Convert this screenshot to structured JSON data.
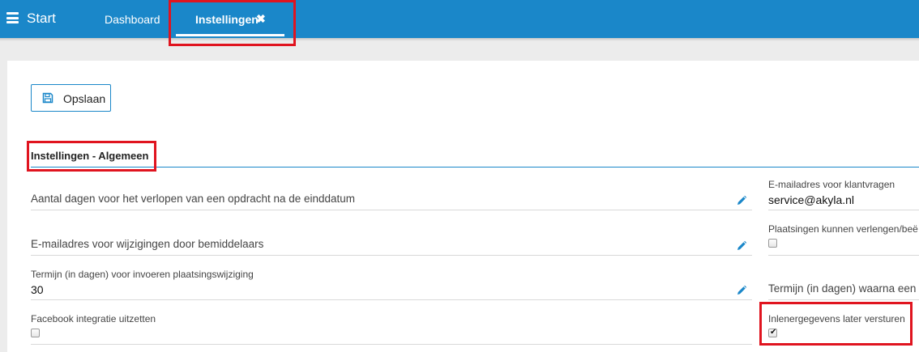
{
  "topbar": {
    "brand": "Start",
    "tabs": [
      {
        "label": "Dashboard"
      },
      {
        "label": "Instellingen",
        "close": "✖"
      }
    ]
  },
  "toolbar": {
    "save_label": "Opslaan"
  },
  "section": {
    "title": "Instellingen - Algemeen"
  },
  "left_fields": [
    {
      "label": "Aantal dagen voor het verlopen van een opdracht na de einddatum"
    },
    {
      "label": "E-mailadres voor wijzigingen door bemiddelaars"
    },
    {
      "label": "Termijn (in dagen) voor invoeren plaatsingswijziging",
      "value": "30"
    },
    {
      "label": "Facebook integratie uitzetten",
      "checked": false
    }
  ],
  "right_fields": [
    {
      "label": "E-mailadres voor klantvragen",
      "value": "service@akyla.nl"
    },
    {
      "label": "Plaatsingen kunnen verlengen/beë",
      "checked": false
    },
    {
      "label": "Termijn (in dagen) waarna een fl"
    },
    {
      "label": "Inlenergegevens later versturen",
      "checked": true
    }
  ],
  "icons": {
    "menu": "hamburger-icon",
    "save": "floppy-disk-icon",
    "edit": "pencil-icon",
    "close": "close-icon"
  },
  "colors": {
    "topbar": "#1a87c9",
    "accent": "#1a87c9",
    "highlight": "#e0141f"
  }
}
